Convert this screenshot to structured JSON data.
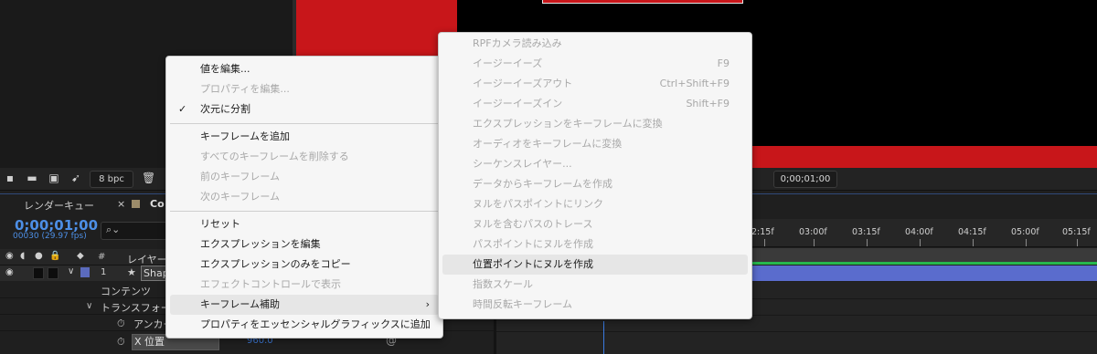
{
  "toolbar": {
    "bpc_label": "8 bpc",
    "timecode": "0;00;01;00"
  },
  "timeline": {
    "tab_render_queue": "レンダーキュー",
    "tab_close": "×",
    "tab_comp_name": "Co",
    "current_time": "0;00;01;00",
    "frame_info": "00030 (29.97 fps)",
    "col_num": "#",
    "col_layer_name": "レイヤー名",
    "layer": {
      "number": "1",
      "name": "Shap"
    },
    "rows": {
      "contents": "コンテンツ",
      "transform": "トランスフォーム",
      "anchor": "アンカー",
      "x_position": "X 位置",
      "x_position_value": "960.0"
    },
    "ruler_ticks": [
      "2:15f",
      "03:00f",
      "03:15f",
      "04:00f",
      "04:15f",
      "05:00f",
      "05:15f"
    ]
  },
  "context_menu": {
    "items": [
      {
        "label": "値を編集...",
        "enabled": true
      },
      {
        "label": "プロパティを編集...",
        "enabled": false
      },
      {
        "label": "次元に分割",
        "enabled": true,
        "checked": true
      },
      {
        "label": "キーフレームを追加",
        "enabled": true
      },
      {
        "label": "すべてのキーフレームを削除する",
        "enabled": false
      },
      {
        "label": "前のキーフレーム",
        "enabled": false
      },
      {
        "label": "次のキーフレーム",
        "enabled": false
      },
      {
        "label": "リセット",
        "enabled": true
      },
      {
        "label": "エクスプレッションを編集",
        "enabled": true
      },
      {
        "label": "エクスプレッションのみをコピー",
        "enabled": true
      },
      {
        "label": "エフェクトコントロールで表示",
        "enabled": false
      },
      {
        "label": "キーフレーム補助",
        "enabled": true,
        "submenu": true
      },
      {
        "label": "プロパティをエッセンシャルグラフィックスに追加",
        "enabled": true
      }
    ]
  },
  "submenu": {
    "items": [
      {
        "label": "RPFカメラ読み込み",
        "enabled": false,
        "shortcut": ""
      },
      {
        "label": "イージーイーズ",
        "enabled": false,
        "shortcut": "F9"
      },
      {
        "label": "イージーイーズアウト",
        "enabled": false,
        "shortcut": "Ctrl+Shift+F9"
      },
      {
        "label": "イージーイーズイン",
        "enabled": false,
        "shortcut": "Shift+F9"
      },
      {
        "label": "エクスプレッションをキーフレームに変換",
        "enabled": false,
        "shortcut": ""
      },
      {
        "label": "オーディオをキーフレームに変換",
        "enabled": false,
        "shortcut": ""
      },
      {
        "label": "シーケンスレイヤー...",
        "enabled": false,
        "shortcut": ""
      },
      {
        "label": "データからキーフレームを作成",
        "enabled": false,
        "shortcut": ""
      },
      {
        "label": "ヌルをパスポイントにリンク",
        "enabled": false,
        "shortcut": ""
      },
      {
        "label": "ヌルを含むパスのトレース",
        "enabled": false,
        "shortcut": ""
      },
      {
        "label": "パスポイントにヌルを作成",
        "enabled": false,
        "shortcut": ""
      },
      {
        "label": "位置ポイントにヌルを作成",
        "enabled": true,
        "shortcut": ""
      },
      {
        "label": "指数スケール",
        "enabled": false,
        "shortcut": ""
      },
      {
        "label": "時間反転キーフレーム",
        "enabled": false,
        "shortcut": ""
      }
    ]
  },
  "colors": {
    "comp_red": "#c8161a",
    "timecode_blue": "#4d8fe6",
    "layer_bar": "#5a6ccd",
    "menu_bg": "#f6f6f6"
  }
}
